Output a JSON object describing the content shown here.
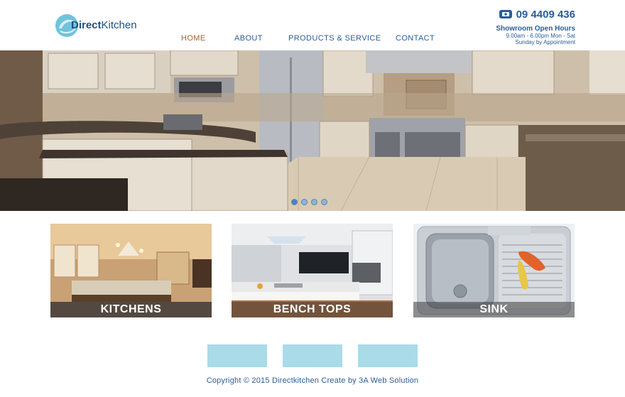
{
  "header": {
    "logo_bold": "Direct",
    "logo_rest": "Kitchen",
    "phone": "09 4409 436",
    "showroom_title": "Showroom Open Hours",
    "hours_weekday": "9.00am - 6.00pm Mon - Sat",
    "hours_sunday": "Sunday by Appointment"
  },
  "nav": {
    "items": [
      {
        "label": "HOME",
        "active": true
      },
      {
        "label": "ABOUT",
        "active": false
      },
      {
        "label": "PRODUCTS & SERVICE",
        "active": false
      },
      {
        "label": "CONTACT",
        "active": false
      }
    ]
  },
  "slider": {
    "slide_count": 4,
    "active_index": 0
  },
  "tiles": [
    {
      "label": "KITCHENS"
    },
    {
      "label": "BENCH TOPS"
    },
    {
      "label": "SINK"
    }
  ],
  "footer": {
    "copyright": "Copyright © 2015 Directkitchen Create by 3A Web Solution"
  },
  "colors": {
    "nav_text": "#2a5d9a",
    "nav_active": "#a0643a",
    "footer_box": "#a9dbe9"
  }
}
